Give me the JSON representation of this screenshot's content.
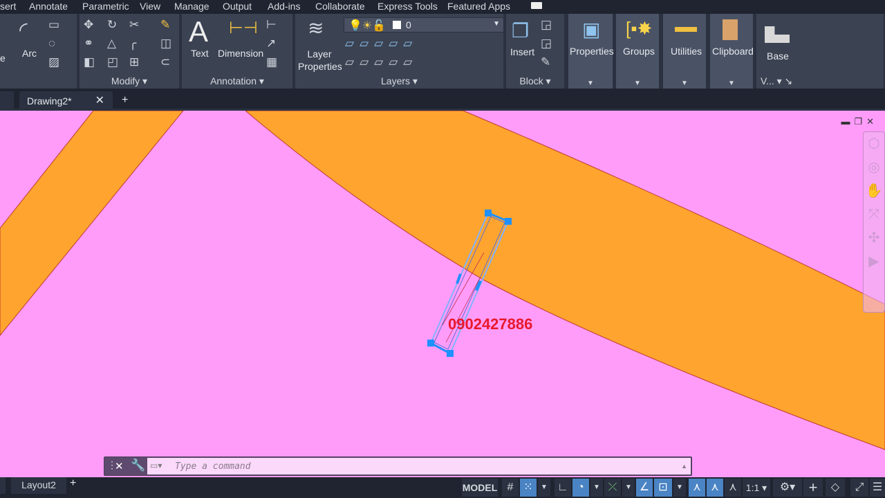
{
  "menu_tabs": [
    "sert",
    "Annotate",
    "Parametric",
    "View",
    "Manage",
    "Output",
    "Add-ins",
    "Collaborate",
    "Express Tools",
    "Featured Apps"
  ],
  "ribbon": {
    "draw": {
      "circle_label": "e",
      "arc_label": "Arc"
    },
    "modify": {
      "label": "Modify"
    },
    "annotation": {
      "label": "Annotation",
      "text_label": "Text",
      "dimension_label": "Dimension"
    },
    "layers": {
      "label": "Layers",
      "layer_properties_label": "Layer Properties",
      "current_layer": "0"
    },
    "block": {
      "label": "Block",
      "insert_label": "Insert"
    },
    "properties_label": "Properties",
    "groups_label": "Groups",
    "utilities_label": "Utilities",
    "clipboard_label": "Clipboard",
    "view": {
      "base_label": "Base",
      "label": "V..."
    }
  },
  "document_tabs": [
    {
      "label": "Drawing2*",
      "active": true
    }
  ],
  "canvas": {
    "background": "#ff9cfa",
    "band_color": "#ffa52f",
    "annotation_text": "0902427886",
    "annotation_color": "#e8192c",
    "grip_color": "#1e90ff"
  },
  "command_line": {
    "placeholder": "Type a command"
  },
  "layout_tabs": [
    "Layout2"
  ],
  "status_bar": {
    "model_label": "MODEL",
    "scale_label": "1:1"
  }
}
